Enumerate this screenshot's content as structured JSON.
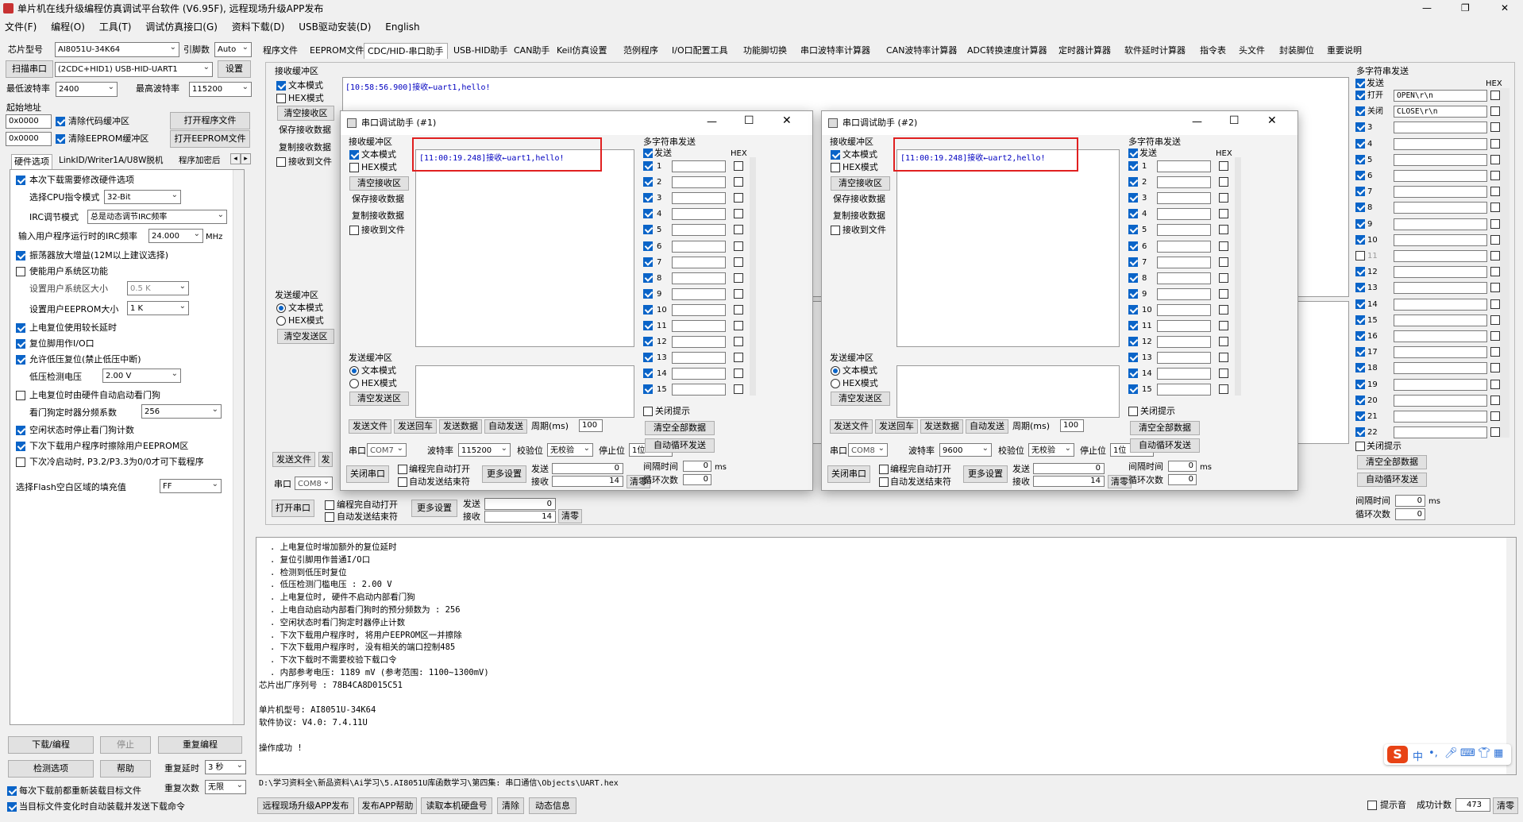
{
  "app": {
    "title": "单片机在线升级编程仿真调试平台软件 (V6.95F), 远程现场升级APP发布",
    "win_controls": [
      "—",
      "❐",
      "✕"
    ]
  },
  "menu": [
    "文件(F)",
    "编程(O)",
    "工具(T)",
    "调试仿真接口(G)",
    "资料下载(D)",
    "USB驱动安装(D)",
    "English"
  ],
  "left": {
    "chip_label": "芯片型号",
    "chip_value": "AI8051U-34K64",
    "pin_label": "引脚数",
    "pin_value": "Auto",
    "scan_btn": "扫描串口",
    "port_value": "(2CDC+HID1) USB-HID-UART1",
    "settings_btn": "设置",
    "min_baud_label": "最低波特率",
    "min_baud": "2400",
    "max_baud_label": "最高波特率",
    "max_baud": "115200",
    "start_addr_label": "起始地址",
    "addr1": "0x0000",
    "clear_code_label": "清除代码缓冲区",
    "open_prog_btn": "打开程序文件",
    "addr2": "0x0000",
    "clear_eeprom_label": "清除EEPROM缓冲区",
    "open_eeprom_btn": "打开EEPROM文件",
    "subtabs": [
      "硬件选项",
      "LinkID/Writer1A/U8W脱机",
      "程序加密后"
    ],
    "opts": {
      "o1": "本次下载需要修改硬件选项",
      "cpu_label": "选择CPU指令模式",
      "cpu_value": "32-Bit",
      "irc_label": "IRC调节模式",
      "irc_value": "总是动态调节IRC频率",
      "freq_label": "输入用户程序运行时的IRC频率",
      "freq_value": "24.000",
      "freq_unit": "MHz",
      "o2": "振荡器放大增益(12M以上建议选择)",
      "o3": "使能用户系统区功能",
      "sys_size_label": "设置用户系统区大小",
      "sys_size": "0.5 K",
      "eeprom_size_label": "设置用户EEPROM大小",
      "eeprom_size": "1   K",
      "o4": "上电复位使用较长延时",
      "o5": "复位脚用作I/O口",
      "o6": "允许低压复位(禁止低压中断)",
      "lv_label": "低压检测电压",
      "lv_value": "2.00 V",
      "o7": "上电复位时由硬件自动启动看门狗",
      "wdt_label": "看门狗定时器分频系数",
      "wdt_value": "256",
      "o8": "空闲状态时停止看门狗计数",
      "o9": "下次下载用户程序时擦除用户EEPROM区",
      "o10": "下次冷启动时, P3.2/P3.3为0/0才可下载程序",
      "flash_label": "选择Flash空白区域的填充值",
      "flash_value": "FF"
    },
    "download_btn": "下载/编程",
    "stop_btn": "停止",
    "reprog_btn": "重复编程",
    "check_btn": "检测选项",
    "help_btn": "帮助",
    "delay_label": "重复延时",
    "delay_value": "3 秒",
    "count_label": "重复次数",
    "count_value": "无限",
    "b1": "每次下载前都重新装载目标文件",
    "b2": "当目标文件变化时自动装载并发送下载命令"
  },
  "tabs": [
    "程序文件",
    "EEPROM文件",
    "CDC/HID-串口助手",
    "USB-HID助手",
    "CAN助手",
    "Keil仿真设置",
    "范例程序",
    "I/O口配置工具",
    "功能脚切换",
    "串口波特率计算器",
    "CAN波特率计算器",
    "ADC转换速度计算器",
    "定时器计算器",
    "软件延时计算器",
    "指令表",
    "头文件",
    "封装脚位",
    "重要说明"
  ],
  "main": {
    "recv_title": "接收缓冲区",
    "text_mode": "文本模式",
    "hex_mode": "HEX模式",
    "clear_recv": "清空接收区",
    "save_recv": "保存接收数据",
    "copy_recv": "复制接收数据",
    "recv_file": "接收到文件",
    "recv_text": "[10:58:56.900]接收←uart1,hello!",
    "send_title": "发送缓冲区",
    "clear_send": "清空发送区",
    "send_file": "发送文件",
    "send_short": "发",
    "port_label": "串口",
    "port": "COM8",
    "open_port": "打开串口",
    "auto_open": "编程完自动打开",
    "auto_end": "自动发送结束符",
    "more": "更多设置",
    "sent_label": "发送",
    "sent": "0",
    "recv_label": "接收",
    "recvd": "14",
    "clear_count": "清零",
    "multi_title": "多字符串发送",
    "send_col": "发送",
    "hex_col": "HEX",
    "rows": [
      {
        "n": "打开",
        "v": "OPEN\\r\\n",
        "on": true
      },
      {
        "n": "关闭",
        "v": "CLOSE\\r\\n",
        "on": true
      },
      {
        "n": "3",
        "v": "",
        "on": true
      },
      {
        "n": "4",
        "v": "",
        "on": true
      },
      {
        "n": "5",
        "v": "",
        "on": true
      },
      {
        "n": "6",
        "v": "",
        "on": true
      },
      {
        "n": "7",
        "v": "",
        "on": true
      },
      {
        "n": "8",
        "v": "",
        "on": true
      },
      {
        "n": "9",
        "v": "",
        "on": true
      },
      {
        "n": "10",
        "v": "",
        "on": true
      },
      {
        "n": "11",
        "v": "",
        "on": false
      },
      {
        "n": "12",
        "v": "",
        "on": true
      },
      {
        "n": "13",
        "v": "",
        "on": true
      },
      {
        "n": "14",
        "v": "",
        "on": true
      },
      {
        "n": "15",
        "v": "",
        "on": true
      },
      {
        "n": "16",
        "v": "",
        "on": true
      },
      {
        "n": "17",
        "v": "",
        "on": true
      },
      {
        "n": "18",
        "v": "",
        "on": true
      },
      {
        "n": "19",
        "v": "",
        "on": true
      },
      {
        "n": "20",
        "v": "",
        "on": true
      },
      {
        "n": "21",
        "v": "",
        "on": true
      },
      {
        "n": "22",
        "v": "",
        "on": true
      }
    ],
    "close_tip": "关闭提示",
    "clear_all": "清空全部数据",
    "auto_loop": "自动循环发送",
    "interval_label": "间隔时间",
    "interval": "0",
    "ms": "ms",
    "loops_label": "循环次数",
    "loops": "0"
  },
  "w1": {
    "title": "串口调试助手 (#1)",
    "recv_text": "[11:00:19.248]接收←uart1,hello!",
    "port": "COM7",
    "baud": "115200",
    "check": "无校验",
    "stop": "1位",
    "period": "100",
    "sent": "0",
    "recvd": "14"
  },
  "w2": {
    "title": "串口调试助手 (#2)",
    "recv_text": "[11:00:19.248]接收←uart2,hello!",
    "port": "COM8",
    "baud": "9600",
    "check": "无校验",
    "stop": "1位",
    "period": "100",
    "sent": "0",
    "recvd": "14"
  },
  "wl": {
    "recv_title": "接收缓冲区",
    "text_mode": "文本模式",
    "hex_mode": "HEX模式",
    "clear_recv": "清空接收区",
    "save_recv": "保存接收数据",
    "copy_recv": "复制接收数据",
    "recv_file": "接收到文件",
    "send_title": "发送缓冲区",
    "clear_send": "清空发送区",
    "multi_title": "多字符串发送",
    "send_col": "发送",
    "hex_col": "HEX",
    "send_file": "发送文件",
    "send_cr": "发送回车",
    "send_data": "发送数据",
    "auto_send": "自动发送",
    "period_label": "周期(ms)",
    "port_label": "串口",
    "baud_label": "波特率",
    "check_label": "校验位",
    "stop_label": "停止位",
    "close_port": "关闭串口",
    "auto_open": "编程完自动打开",
    "auto_end": "自动发送结束符",
    "more": "更多设置",
    "sent_label": "发送",
    "recv_label": "接收",
    "clear_count": "清零",
    "close_tip": "关闭提示",
    "clear_all": "清空全部数据",
    "auto_loop": "自动循环发送",
    "interval_label": "间隔时间",
    "interval": "0",
    "ms": "ms",
    "loops_label": "循环次数",
    "loops": "0",
    "rows": [
      "1",
      "2",
      "3",
      "4",
      "5",
      "6",
      "7",
      "8",
      "9",
      "10",
      "11",
      "12",
      "13",
      "14",
      "15"
    ]
  },
  "log": [
    ". 上电复位时增加额外的复位延时",
    ". 复位引脚用作普通I/O口",
    ". 检测到低压时复位",
    ". 低压检测门槛电压 : 2.00 V",
    ". 上电复位时, 硬件不启动内部看门狗",
    ". 上电自动启动内部看门狗时的预分频数为 : 256",
    ". 空闲状态时看门狗定时器停止计数",
    ". 下次下载用户程序时, 将用户EEPROM区一并擦除",
    ". 下次下载用户程序时, 没有相关的端口控制485",
    ". 下次下载时不需要校验下载口令",
    ". 内部参考电压: 1189 mV (参考范围: 1100~1300mV)",
    "芯片出厂序列号 : 78B4CA8D015C51",
    "",
    "  单片机型号: AI8051U-34K64",
    "  软件协议: V4.0: 7.4.11U",
    "",
    "操作成功 !"
  ],
  "path": "D:\\学习资料全\\新品资料\\Ai学习\\5.AI8051U库函数学习\\第四集: 串口通信\\Objects\\UART.hex",
  "bottom": {
    "b1": "远程现场升级APP发布",
    "b2": "发布APP帮助",
    "b3": "读取本机硬盘号",
    "b4": "清除",
    "b5": "动态信息",
    "tip": "提示音",
    "count_label": "成功计数",
    "count": "473",
    "clear": "清零"
  },
  "ime": {
    "logo": "S",
    "mode": "中"
  }
}
